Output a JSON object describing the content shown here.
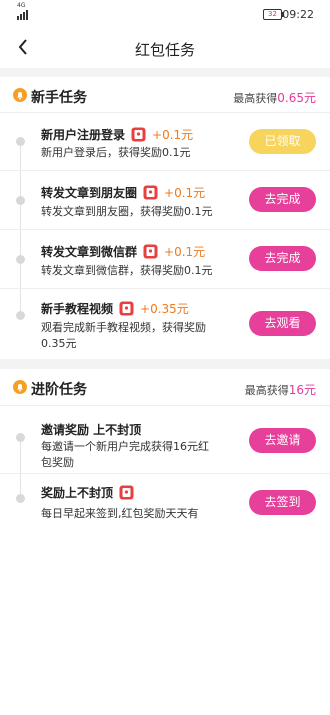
{
  "status_bar": {
    "network": "4G",
    "battery": "32",
    "time": "09:22"
  },
  "nav": {
    "title": "红包任务"
  },
  "sections": [
    {
      "title": "新手任务",
      "max_label": "最高获得",
      "max_amount": "0.65元",
      "tasks": [
        {
          "name": "新用户注册登录",
          "reward": "+0.1元",
          "desc_lines": [
            "新用户登录后，获得奖励0.1元"
          ],
          "button": "已领取",
          "completed": true
        },
        {
          "name": "转发文章到朋友圈",
          "reward": "+0.1元",
          "desc_lines": [
            "转发文章到朋友圈，获得奖励0.1元"
          ],
          "button": "去完成",
          "completed": false
        },
        {
          "name": "转发文章到微信群",
          "reward": "+0.1元",
          "desc_lines": [
            "转发文章到微信群，获得奖励0.1元"
          ],
          "button": "去完成",
          "completed": false
        },
        {
          "name": "新手教程视频",
          "reward": "+0.35元",
          "desc_lines": [
            "观看完成新手教程视频，获得奖励",
            "0.35元"
          ],
          "button": "去观看",
          "completed": false
        }
      ]
    },
    {
      "title": "进阶任务",
      "max_label": "最高获得",
      "max_amount": "16元",
      "tasks": [
        {
          "name": "邀请奖励 上不封顶",
          "reward": "",
          "desc_lines": [
            "每邀请一个新用户完成获得16元红",
            "包奖励"
          ],
          "button": "去邀请",
          "completed": false
        },
        {
          "name": "奖励上不封顶",
          "reward": "",
          "desc_lines": [
            "每日早起来签到,红包奖励天天有"
          ],
          "button": "去签到",
          "completed": false
        }
      ]
    }
  ],
  "colors": {
    "accent": "#e6409a",
    "reward": "#f07a1c",
    "done": "#f7d45c",
    "bell": "#f6a023"
  },
  "icons": {
    "back": "chevron-left-icon",
    "section": "bell-icon",
    "task": "red-packet-icon"
  }
}
